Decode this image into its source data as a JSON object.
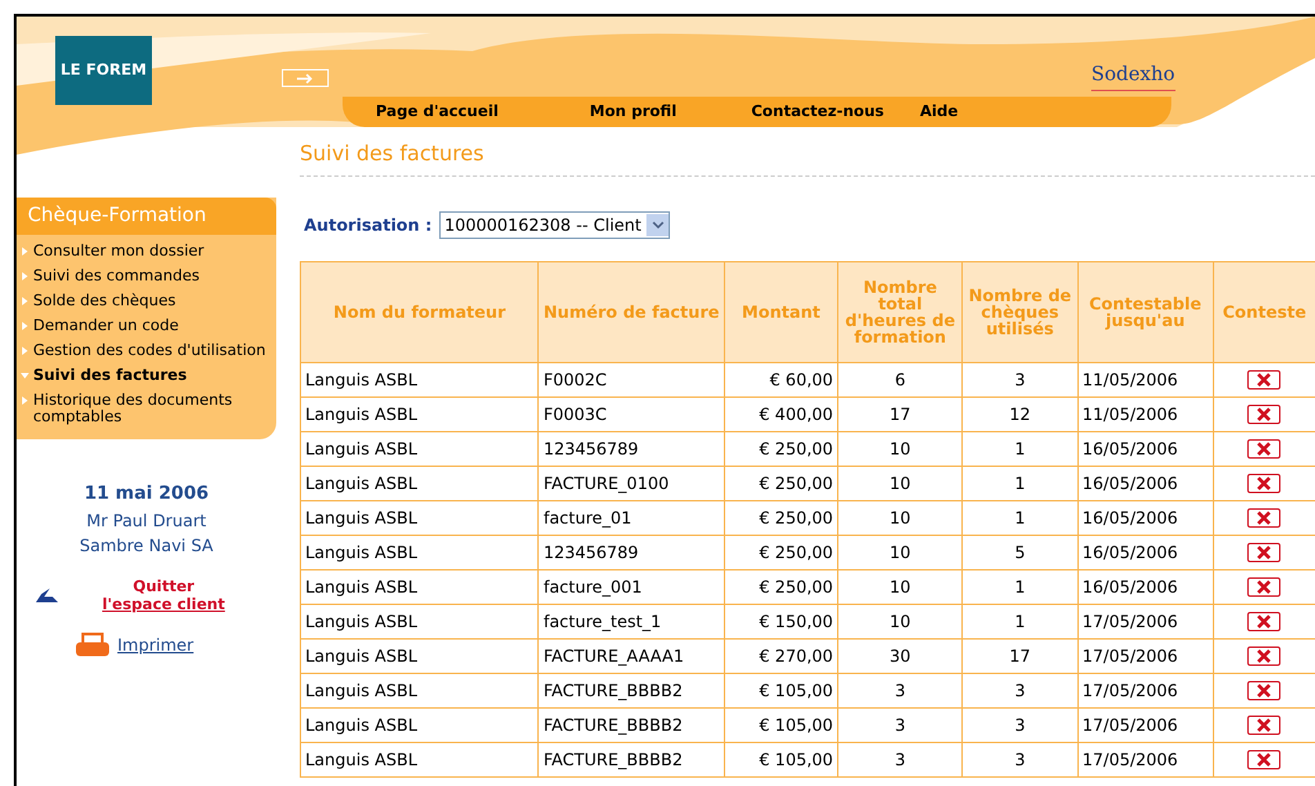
{
  "header": {
    "logo": "LE FOREM",
    "partner_logo": "Sodexho",
    "nav": [
      "Page d'accueil",
      "Mon profil",
      "Contactez-nous",
      "Aide"
    ]
  },
  "page_title": "Suivi des factures",
  "sidebar": {
    "title": "Chèque-Formation",
    "items": [
      {
        "label": "Consulter mon dossier",
        "selected": false
      },
      {
        "label": "Suivi des commandes",
        "selected": false
      },
      {
        "label": "Solde des chèques",
        "selected": false
      },
      {
        "label": "Demander un code",
        "selected": false
      },
      {
        "label": "Gestion des codes d'utilisation",
        "selected": false
      },
      {
        "label": "Suivi des factures",
        "selected": true
      },
      {
        "label": "Historique des documents comptables",
        "selected": false
      }
    ],
    "date": "11 mai 2006",
    "user": "Mr Paul Druart",
    "company": "Sambre Navi SA",
    "logout": [
      "Quitter",
      "l'espace client"
    ],
    "print": "Imprimer"
  },
  "filter": {
    "label": "Autorisation :",
    "value": "100000162308 -- Client"
  },
  "table": {
    "columns": [
      "Nom du formateur",
      "Numéro de facture",
      "Montant",
      "Nombre total d'heures de formation",
      "Nombre de chèques utilisés",
      "Contestable jusqu'au",
      "Conteste"
    ],
    "rows": [
      [
        "Languis ASBL",
        "F0002C",
        "€ 60,00",
        "6",
        "3",
        "11/05/2006"
      ],
      [
        "Languis ASBL",
        "F0003C",
        "€ 400,00",
        "17",
        "12",
        "11/05/2006"
      ],
      [
        "Languis ASBL",
        "123456789",
        "€ 250,00",
        "10",
        "1",
        "16/05/2006"
      ],
      [
        "Languis ASBL",
        "FACTURE_0100",
        "€ 250,00",
        "10",
        "1",
        "16/05/2006"
      ],
      [
        "Languis ASBL",
        "facture_01",
        "€ 250,00",
        "10",
        "1",
        "16/05/2006"
      ],
      [
        "Languis ASBL",
        "123456789",
        "€ 250,00",
        "10",
        "5",
        "16/05/2006"
      ],
      [
        "Languis ASBL",
        "facture_001",
        "€ 250,00",
        "10",
        "1",
        "16/05/2006"
      ],
      [
        "Languis ASBL",
        "facture_test_1",
        "€ 150,00",
        "10",
        "1",
        "17/05/2006"
      ],
      [
        "Languis ASBL",
        "FACTURE_AAAA1",
        "€ 270,00",
        "30",
        "17",
        "17/05/2006"
      ],
      [
        "Languis ASBL",
        "FACTURE_BBBB2",
        "€ 105,00",
        "3",
        "3",
        "17/05/2006"
      ],
      [
        "Languis ASBL",
        "FACTURE_BBBB2",
        "€ 105,00",
        "3",
        "3",
        "17/05/2006"
      ],
      [
        "Languis ASBL",
        "FACTURE_BBBB2",
        "€ 105,00",
        "3",
        "3",
        "17/05/2006"
      ]
    ]
  }
}
